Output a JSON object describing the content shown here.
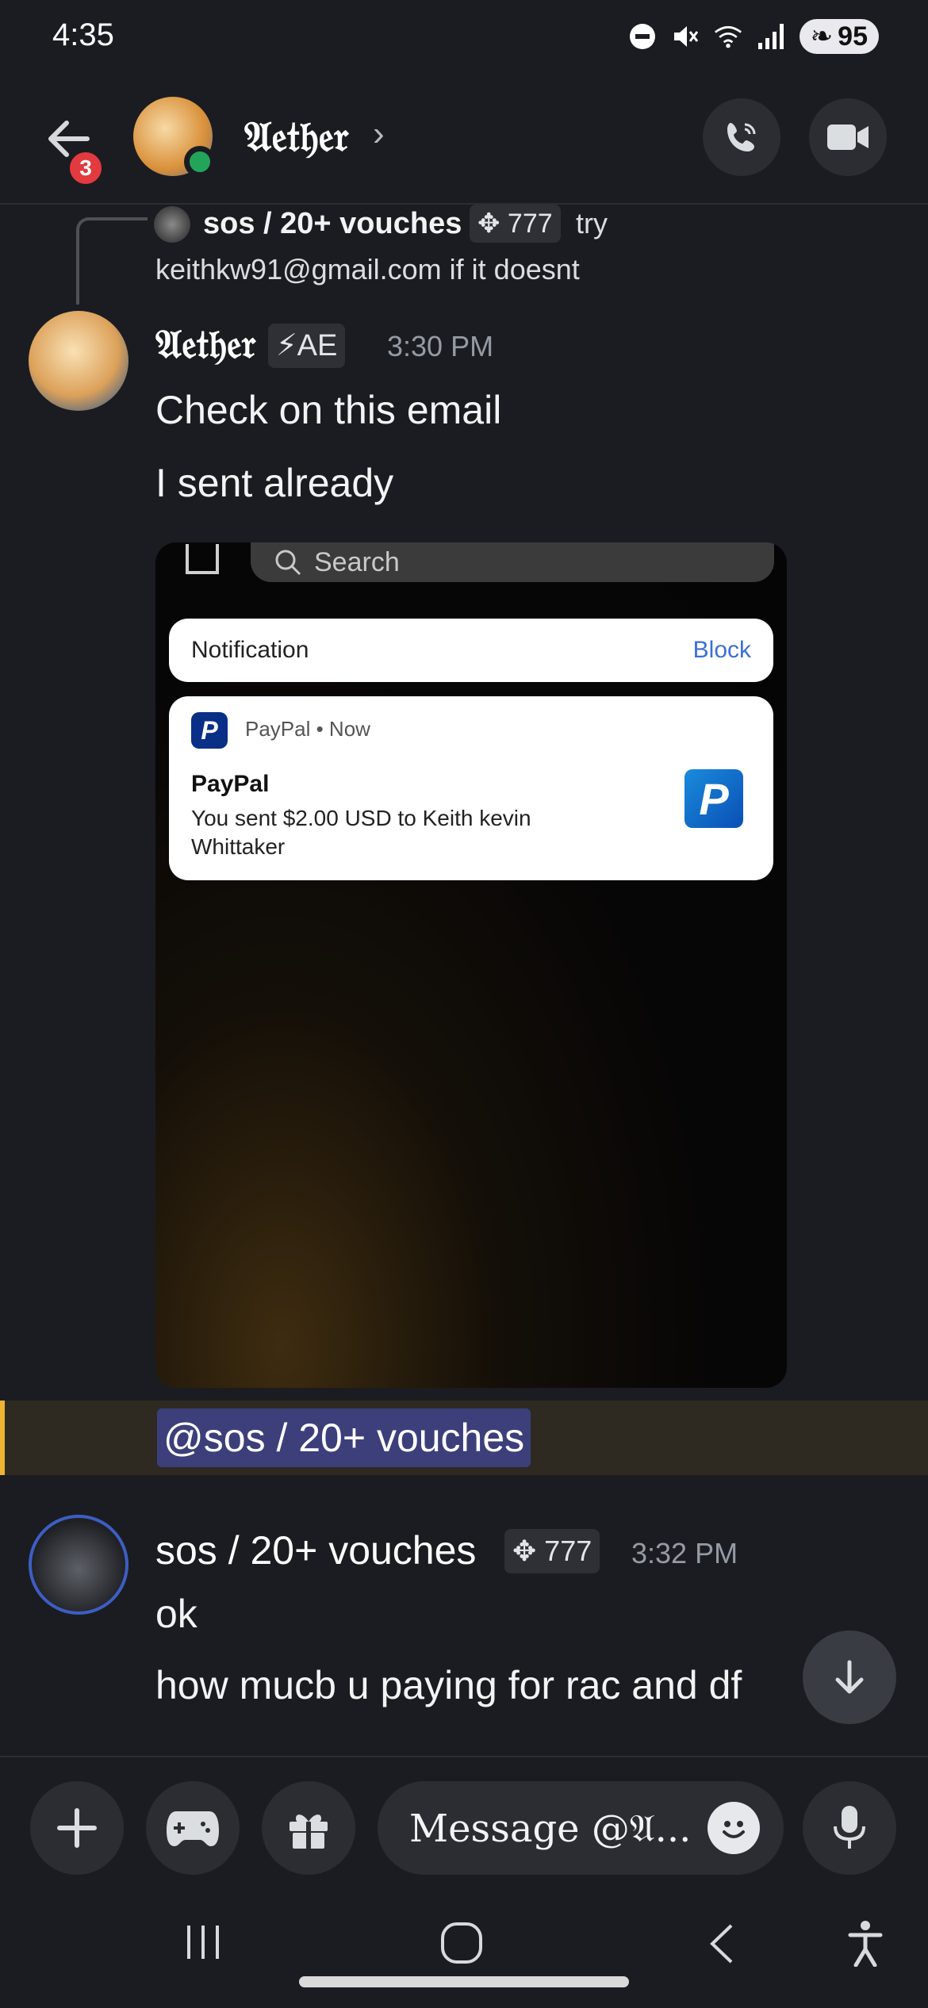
{
  "status_bar": {
    "time": "4:35",
    "battery": "95"
  },
  "header": {
    "back_badge": "3",
    "title": "𝔄𝔢𝔱𝔥𝔢𝔯",
    "chevron": "›"
  },
  "reply": {
    "author": "sos / 20+ vouches",
    "tag": "✥ 777",
    "text_end": "try",
    "text_line2": "keithkw91@gmail.com if it doesnt"
  },
  "messages": [
    {
      "author": "𝔄𝔢𝔱𝔥𝔢𝔯",
      "tag": "⚡AE",
      "timestamp": "3:30 PM",
      "lines": [
        "Check on this email",
        "I sent already"
      ]
    },
    {
      "author": "sos / 20+ vouches",
      "tag": "✥ 777",
      "timestamp": "3:32 PM",
      "lines": [
        "ok",
        "how mucb u paying for rac and df"
      ]
    }
  ],
  "embed": {
    "search_placeholder": "Search",
    "notification_label": "Notification",
    "block_label": "Block",
    "app_meta": "PayPal • Now",
    "notif_title": "PayPal",
    "notif_body": "You sent $2.00 USD  to Keith kevin Whittaker",
    "logo_letter": "P"
  },
  "mention": "@sos / 20+ vouches",
  "composer": {
    "placeholder": "Message @𝔄...",
    "colors": {
      "accent_online": "#23a559",
      "mention_bar": "#f0b232"
    }
  }
}
